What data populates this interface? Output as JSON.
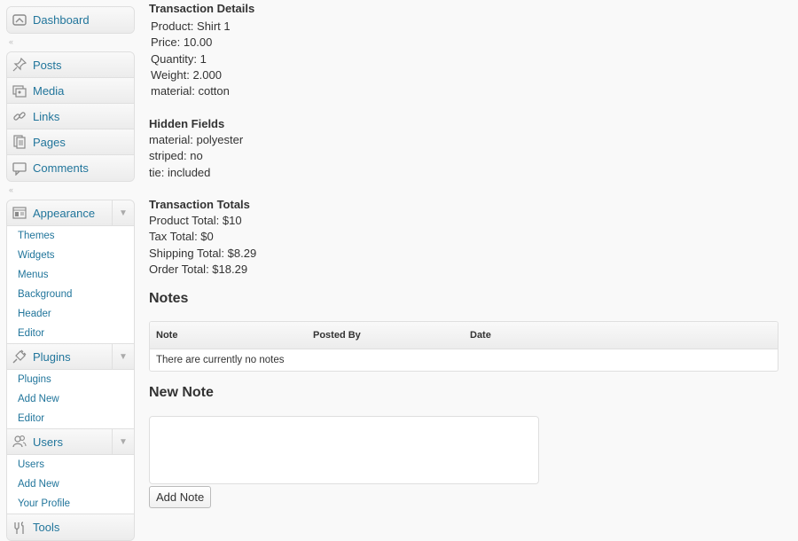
{
  "sidebar": {
    "dashboard": {
      "label": "Dashboard",
      "icon": "dashboard-icon"
    },
    "separator_glyph": "«",
    "group1": [
      {
        "label": "Posts",
        "icon": "pushpin-icon"
      },
      {
        "label": "Media",
        "icon": "media-icon"
      },
      {
        "label": "Links",
        "icon": "link-icon"
      },
      {
        "label": "Pages",
        "icon": "pages-icon"
      },
      {
        "label": "Comments",
        "icon": "comment-icon"
      }
    ],
    "appearance": {
      "label": "Appearance",
      "items": [
        "Themes",
        "Widgets",
        "Menus",
        "Background",
        "Header",
        "Editor"
      ]
    },
    "plugins": {
      "label": "Plugins",
      "items": [
        "Plugins",
        "Add New",
        "Editor"
      ]
    },
    "users": {
      "label": "Users",
      "items": [
        "Users",
        "Add New",
        "Your Profile"
      ]
    },
    "tools": {
      "label": "Tools"
    }
  },
  "transaction_details": {
    "heading": "Transaction Details",
    "lines": [
      "Product: Shirt 1",
      "Price: 10.00",
      "Quantity: 1",
      "Weight: 2.000",
      "material: cotton"
    ]
  },
  "hidden_fields": {
    "heading": "Hidden Fields",
    "lines": [
      "material: polyester",
      "striped: no",
      "tie: included"
    ]
  },
  "transaction_totals": {
    "heading": "Transaction Totals",
    "lines": [
      "Product Total: $10",
      "Tax Total: $0",
      "Shipping Total: $8.29",
      "Order Total: $18.29"
    ]
  },
  "notes": {
    "heading": "Notes",
    "columns": [
      "Note",
      "Posted By",
      "Date"
    ],
    "empty_message": "There are currently no notes"
  },
  "new_note": {
    "heading": "New Note",
    "textarea_value": "",
    "button_label": "Add Note"
  },
  "colors": {
    "link": "#21759b",
    "background": "#f9f9f9",
    "border": "#dfdfdf"
  }
}
